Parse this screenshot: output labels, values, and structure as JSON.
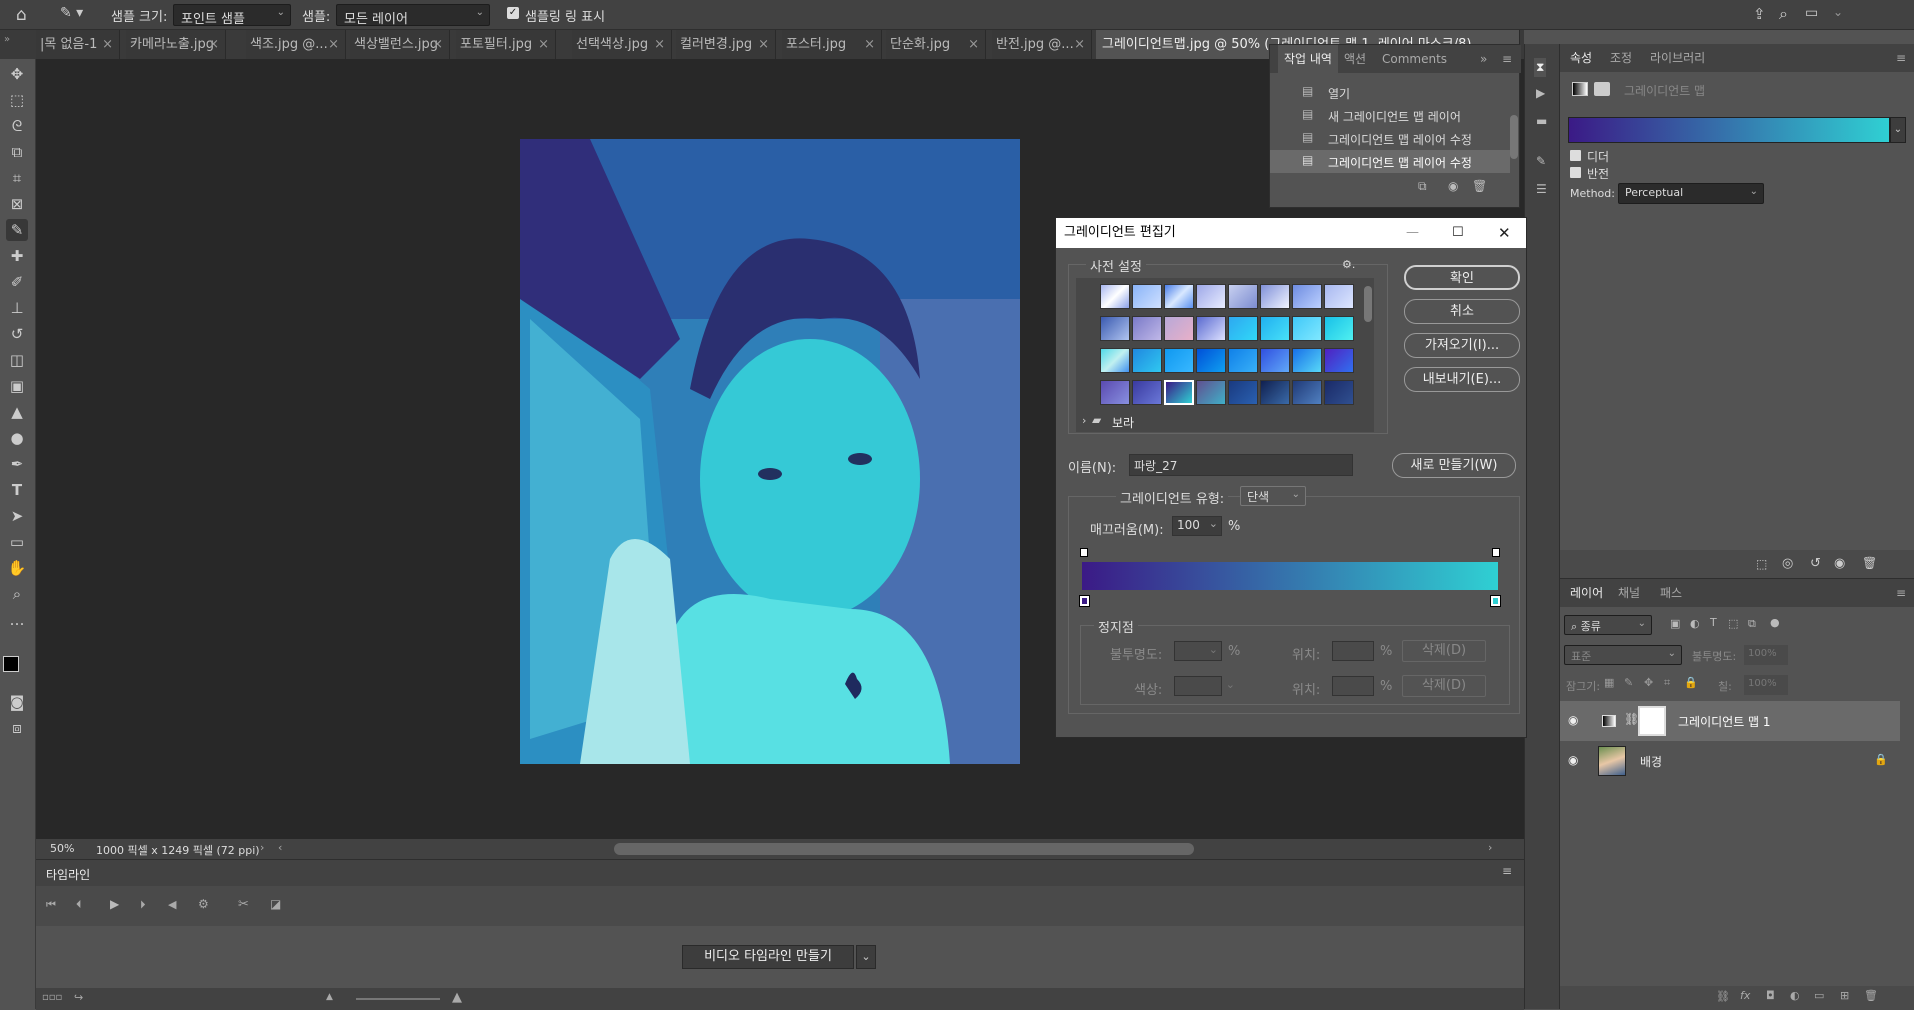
{
  "options": {
    "sample_size_label": "샘플 크기:",
    "sample_size_value": "포인트 샘플",
    "sample_label": "샘플:",
    "sample_value": "모든 레이어",
    "show_ring_label": "샘플링 링 표시"
  },
  "tabs": [
    {
      "label": "|목 없음-1"
    },
    {
      "label": "카메라노출.jpg"
    },
    {
      "label": "색조.jpg @..."
    },
    {
      "label": "색상밸런스.jpg"
    },
    {
      "label": "포토필터.jpg"
    },
    {
      "label": "선택색상.jpg"
    },
    {
      "label": "컬러변경.jpg"
    },
    {
      "label": "포스터.jpg"
    },
    {
      "label": "단순화.jpg"
    },
    {
      "label": "반전.jpg @..."
    },
    {
      "label": "그레이디언트맵.jpg @ 50% (그레이디언트 맵 1, 레이어 마스크/8)"
    }
  ],
  "status": {
    "zoom": "50%",
    "doc_info": "1000 픽셀 x 1249 픽셀 (72 ppi)"
  },
  "history": {
    "tabs": [
      "작업 내역",
      "액션",
      "Comments"
    ],
    "items": [
      "열기",
      "새 그레이디언트 맵 레이어",
      "그레이디언트 맵 레이어 수정",
      "그레이디언트 맵 레이어 수정"
    ]
  },
  "properties": {
    "tabs": [
      "속성",
      "조정",
      "라이브러리"
    ],
    "title": "그레이디언트 맵",
    "dither": "디더",
    "reverse": "반전",
    "method_label": "Method:",
    "method_value": "Perceptual"
  },
  "layers": {
    "tabs": [
      "레이어",
      "채널",
      "패스"
    ],
    "filter": "종류",
    "blend": "표준",
    "opacity_label": "불투명도:",
    "opacity_value": "100%",
    "lock_label": "잠그기:",
    "fill_label": "칠:",
    "fill_value": "100%",
    "items": [
      {
        "name": "그레이디언트 맵 1"
      },
      {
        "name": "배경"
      }
    ]
  },
  "timeline": {
    "title": "타임라인",
    "create_button": "비디오 타임라인 만들기"
  },
  "dialog": {
    "title": "그레이디언트 편집기",
    "presets_label": "사전 설정",
    "folder": "보라",
    "ok": "확인",
    "cancel": "취소",
    "import": "가져오기(I)...",
    "export": "내보내기(E)...",
    "name_label": "이름(N):",
    "name_value": "파랑_27",
    "new_button": "새로 만들기(W)",
    "type_label": "그레이디언트 유형:",
    "type_value": "단색",
    "smoothness_label": "매끄러움(M):",
    "smoothness_value": "100",
    "percent": "%",
    "stops_label": "정지점",
    "opacity_label": "불투명도:",
    "location_label": "위치:",
    "delete_label": "삭제(D)",
    "color_label": "색상:"
  },
  "colors": {
    "gradient_start": "#3b1a86",
    "gradient_end": "#2fd0d3",
    "accent": "#2fd0d3"
  }
}
